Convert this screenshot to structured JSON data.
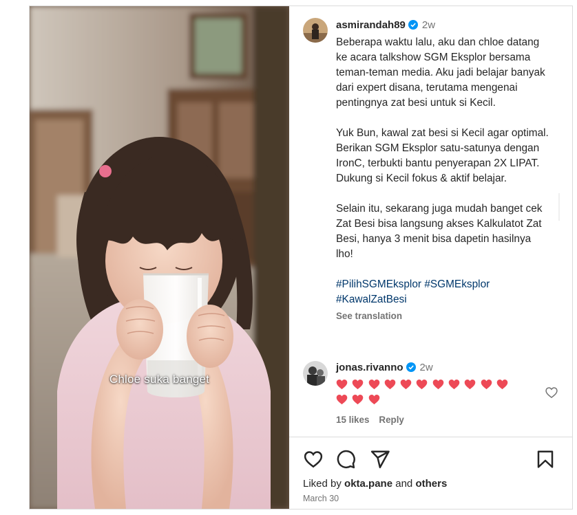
{
  "media": {
    "overlay_text": "Chloe suka banget"
  },
  "owner": {
    "username": "asmirandah89",
    "time": "2w"
  },
  "caption": {
    "paragraph1": "Beberapa waktu lalu, aku dan chloe datang ke acara talkshow SGM Eksplor bersama teman-teman media. Aku jadi belajar banyak dari expert disana, terutama mengenai pentingnya zat besi untuk si Kecil.",
    "paragraph2": "Yuk Bun, kawal zat besi si Kecil agar optimal. Berikan SGM Eksplor satu-satunya dengan IronC, terbukti bantu penyerapan 2X LIPAT. Dukung si Kecil fokus & aktif belajar.",
    "paragraph3": "Selain itu, sekarang juga mudah banget cek Zat Besi bisa langsung akses Kalkulatot Zat Besi, hanya 3 menit bisa dapetin hasilnya lho!",
    "hashtags": [
      "#PilihSGMEksplor",
      "#SGMEksplor",
      "#KawalZatBesi"
    ],
    "see_translation": "See translation"
  },
  "comment": {
    "username": "jonas.rivanno",
    "time": "2w",
    "heart_count": 14,
    "likes": "15 likes",
    "reply": "Reply"
  },
  "actions": {
    "icons": [
      "heart-outline-icon",
      "speech-bubble-icon",
      "paper-plane-icon",
      "bookmark-icon"
    ]
  },
  "liked_by": {
    "prefix": "Liked by",
    "user": "okta.pane",
    "and": "and",
    "others": "others"
  },
  "date": "March 30",
  "colors": {
    "verified": "#0095f6",
    "hashtag": "#00376b",
    "heart": "#ed4956",
    "secondary_text": "#737373"
  }
}
